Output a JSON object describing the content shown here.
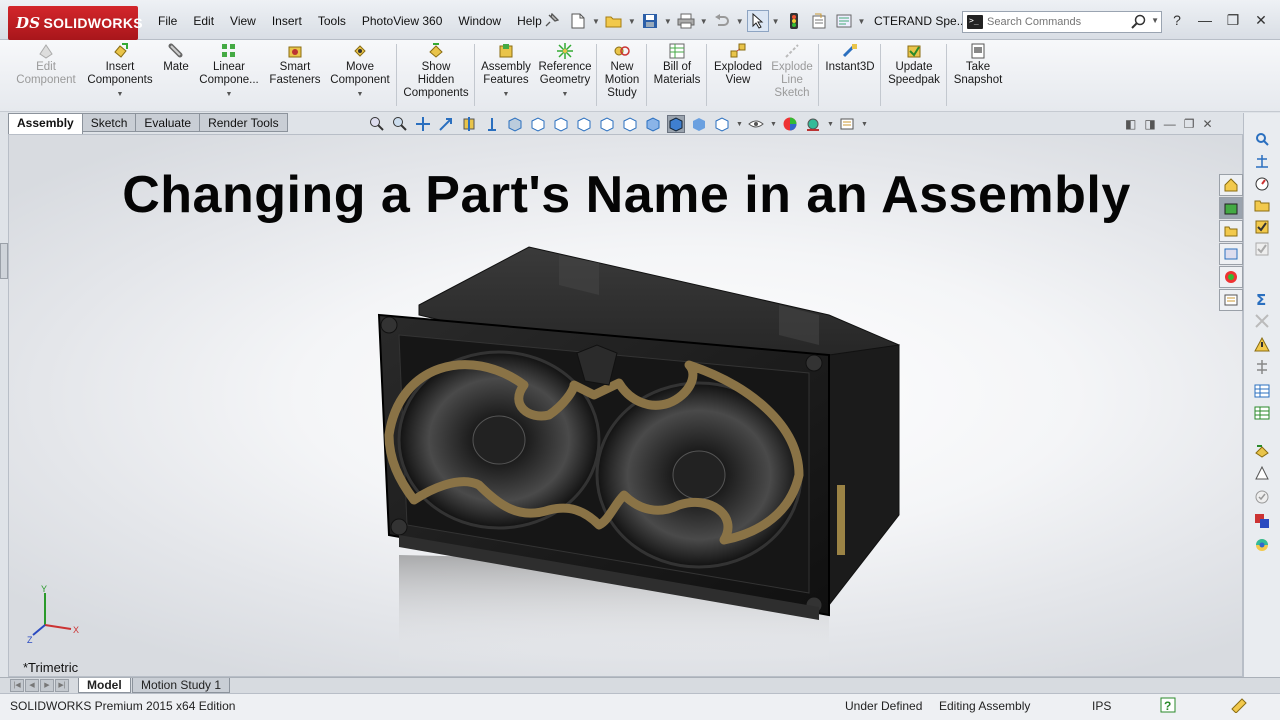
{
  "app": {
    "brand": "SOLIDWORKS",
    "brand_prefix": "DS",
    "document_title": "CTERAND Spe...",
    "accent_color": "#c8232a"
  },
  "menu": [
    "File",
    "Edit",
    "View",
    "Insert",
    "Tools",
    "PhotoView 360",
    "Window",
    "Help"
  ],
  "search": {
    "placeholder": "Search Commands"
  },
  "command_manager": [
    {
      "id": "edit-component",
      "label": "Edit\nComponent",
      "disabled": true,
      "icon": "edit-component-icon"
    },
    {
      "id": "insert-components",
      "label": "Insert\nComponents",
      "disabled": false,
      "icon": "insert-components-icon",
      "dropdown": true
    },
    {
      "id": "mate",
      "label": "Mate",
      "disabled": false,
      "icon": "mate-icon"
    },
    {
      "id": "linear-component-pattern",
      "label": "Linear\nCompone...",
      "disabled": false,
      "icon": "linear-pattern-icon",
      "dropdown": true
    },
    {
      "id": "smart-fasteners",
      "label": "Smart\nFasteners",
      "disabled": false,
      "icon": "smart-fasteners-icon"
    },
    {
      "id": "move-component",
      "label": "Move\nComponent",
      "disabled": false,
      "icon": "move-component-icon",
      "dropdown": true
    },
    {
      "id": "show-hidden-components",
      "label": "Show\nHidden\nComponents",
      "disabled": false,
      "icon": "show-hidden-icon"
    },
    {
      "id": "assembly-features",
      "label": "Assembly\nFeatures",
      "disabled": false,
      "icon": "assembly-features-icon",
      "dropdown": true
    },
    {
      "id": "reference-geometry",
      "label": "Reference\nGeometry",
      "disabled": false,
      "icon": "reference-geometry-icon",
      "dropdown": true
    },
    {
      "id": "new-motion-study",
      "label": "New\nMotion\nStudy",
      "disabled": false,
      "icon": "motion-study-icon"
    },
    {
      "id": "bill-of-materials",
      "label": "Bill of\nMaterials",
      "disabled": false,
      "icon": "bill-of-materials-icon"
    },
    {
      "id": "exploded-view",
      "label": "Exploded\nView",
      "disabled": false,
      "icon": "exploded-view-icon"
    },
    {
      "id": "explode-line-sketch",
      "label": "Explode\nLine\nSketch",
      "disabled": true,
      "icon": "explode-line-icon"
    },
    {
      "id": "instant3d",
      "label": "Instant3D",
      "disabled": false,
      "icon": "instant3d-icon"
    },
    {
      "id": "update-speedpak",
      "label": "Update\nSpeedpak",
      "disabled": false,
      "icon": "speedpak-icon"
    },
    {
      "id": "take-snapshot",
      "label": "Take\nSnapshot",
      "disabled": false,
      "icon": "snapshot-icon"
    }
  ],
  "tabs": [
    {
      "label": "Assembly",
      "active": true
    },
    {
      "label": "Sketch",
      "active": false
    },
    {
      "label": "Evaluate",
      "active": false
    },
    {
      "label": "Render Tools",
      "active": false
    }
  ],
  "viewport": {
    "headline": "Changing a Part's Name in an Assembly",
    "view_orientation": "*Trimetric",
    "triad_labels": {
      "x": "X",
      "y": "Y",
      "z": "Z"
    }
  },
  "bottom_tabs": [
    {
      "label": "Model",
      "active": true
    },
    {
      "label": "Motion Study 1",
      "active": false
    }
  ],
  "status": {
    "product": "SOLIDWORKS Premium 2015 x64 Edition",
    "definition": "Under Defined",
    "mode": "Editing Assembly",
    "units": "IPS"
  }
}
